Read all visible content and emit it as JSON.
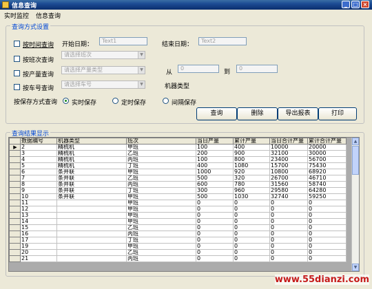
{
  "window": {
    "title": "信息查询",
    "min": "_",
    "max": "□",
    "close": "×"
  },
  "menu": [
    "实时监控",
    "信息查询"
  ],
  "query_group": {
    "legend": "查询方式设置",
    "by_time_label": "按时间查询",
    "by_shift_label": "按班次查询",
    "by_output_label": "按产量查询",
    "by_vehicle_label": "按车号查询",
    "start_date_label": "开始日期：",
    "start_date_value": "Text1",
    "end_date_label": "结束日期：",
    "end_date_value": "Text2",
    "shift_placeholder": "请选择班次",
    "output_placeholder": "请选择产量类型",
    "vehicle_placeholder": "请选择车号",
    "from_label": "从",
    "from_value": "0",
    "to_label": "到",
    "to_value": "0",
    "machine_type_label": "机器类型",
    "save_mode_label": "按保存方式查询",
    "save_options": [
      "实时保存",
      "定时保存",
      "间隔保存"
    ],
    "buttons": {
      "query": "查询",
      "delete": "删除",
      "export": "导出报表",
      "print": "打印"
    }
  },
  "results": {
    "legend": "查询结果显示",
    "columns": [
      "数据编号",
      "机器类型",
      "班次",
      "当日产量",
      "累计产量",
      "当日合计产量",
      "累计合计产量"
    ],
    "rows": [
      [
        "2",
        "精梳机",
        "甲班",
        "100",
        "400",
        "10000",
        "20000"
      ],
      [
        "3",
        "精梳机",
        "乙班",
        "200",
        "900",
        "32100",
        "30000"
      ],
      [
        "4",
        "精梳机",
        "丙班",
        "100",
        "800",
        "23400",
        "56700"
      ],
      [
        "5",
        "精梳机",
        "丁班",
        "400",
        "1080",
        "15700",
        "75430"
      ],
      [
        "6",
        "条并联",
        "甲班",
        "1000",
        "920",
        "10800",
        "68920"
      ],
      [
        "7",
        "条并联",
        "乙班",
        "500",
        "320",
        "26700",
        "46710"
      ],
      [
        "8",
        "条并联",
        "丙班",
        "600",
        "780",
        "31560",
        "58740"
      ],
      [
        "9",
        "条并联",
        "丁班",
        "300",
        "960",
        "29580",
        "64280"
      ],
      [
        "10",
        "条并联",
        "甲班",
        "500",
        "1030",
        "32740",
        "59250"
      ],
      [
        "11",
        "",
        "甲班",
        "0",
        "0",
        "0",
        "0"
      ],
      [
        "12",
        "",
        "甲班",
        "0",
        "0",
        "0",
        "0"
      ],
      [
        "13",
        "",
        "甲班",
        "0",
        "0",
        "0",
        "0"
      ],
      [
        "14",
        "",
        "甲班",
        "0",
        "0",
        "0",
        "0"
      ],
      [
        "15",
        "",
        "乙班",
        "0",
        "0",
        "0",
        "0"
      ],
      [
        "16",
        "",
        "丙班",
        "0",
        "0",
        "0",
        "0"
      ],
      [
        "17",
        "",
        "丁班",
        "0",
        "0",
        "0",
        "0"
      ],
      [
        "19",
        "",
        "甲班",
        "0",
        "0",
        "0",
        "0"
      ],
      [
        "20",
        "",
        "乙班",
        "0",
        "0",
        "0",
        "0"
      ],
      [
        "21",
        "",
        "丙班",
        "0",
        "0",
        "0",
        "0"
      ]
    ],
    "current_row_marker": "▶"
  },
  "watermark": "www.55dianzi.com"
}
